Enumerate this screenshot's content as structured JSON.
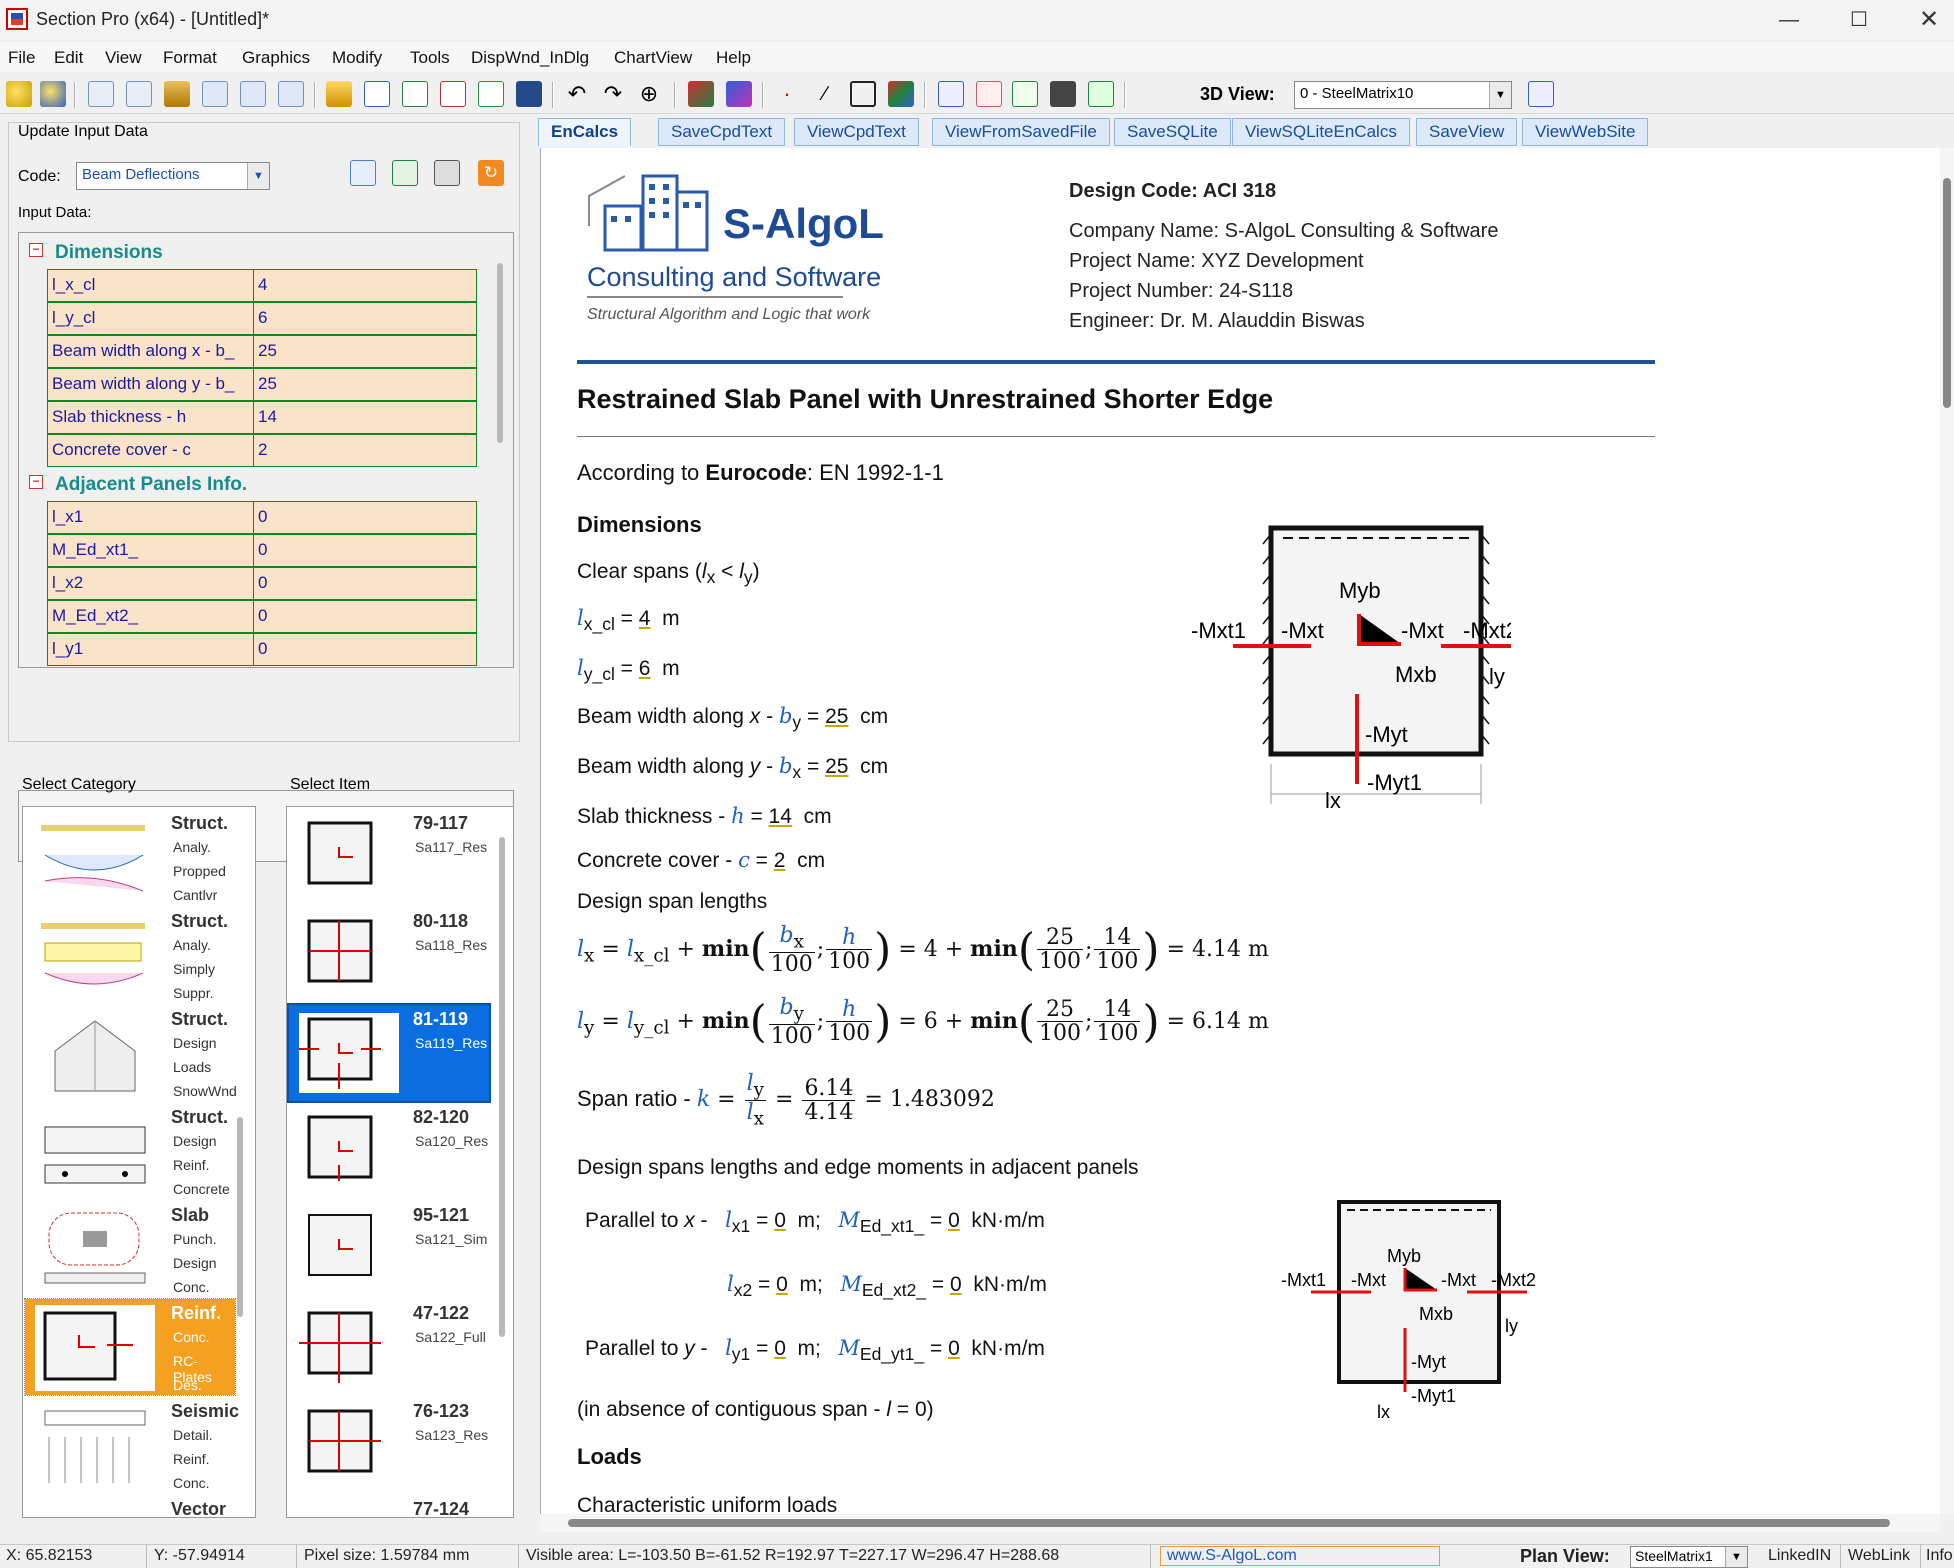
{
  "window": {
    "title": "Section Pro (x64) - [Untitled]*"
  },
  "menu": [
    "File",
    "Edit",
    "View",
    "Format",
    "Graphics",
    "Modify",
    "Tools",
    "DispWnd_InDlg",
    "ChartView",
    "Help"
  ],
  "toolbar": {
    "view3d_label": "3D View:",
    "view3d_value": "0 - SteelMatrix10"
  },
  "left_panel": {
    "header": "Update Input Data",
    "code_label": "Code:",
    "code_value": "Beam Deflections",
    "input_data_label": "Input Data:",
    "groups": [
      {
        "title": "Dimensions",
        "rows": [
          {
            "key": "l_x_cl",
            "value": "4"
          },
          {
            "key": "l_y_cl",
            "value": "6"
          },
          {
            "key": "Beam width along x - b_",
            "value": "25"
          },
          {
            "key": "Beam width along y - b_",
            "value": "25"
          },
          {
            "key": "Slab thickness - h",
            "value": "14"
          },
          {
            "key": "Concrete cover - c",
            "value": "2"
          }
        ]
      },
      {
        "title": "Adjacent Panels Info.",
        "rows": [
          {
            "key": "l_x1",
            "value": "0"
          },
          {
            "key": "M_Ed_xt1_",
            "value": "0"
          },
          {
            "key": "l_x2",
            "value": "0"
          },
          {
            "key": "M_Ed_xt2_",
            "value": "0"
          },
          {
            "key": "l_y1",
            "value": "0"
          }
        ]
      }
    ],
    "select_category_label": "Select Category",
    "select_item_label": "Select Item",
    "categories": [
      {
        "title": "Struct.",
        "lines": [
          "Analy.",
          "Propped",
          "Cantlvr"
        ],
        "selected": false
      },
      {
        "title": "Struct.",
        "lines": [
          "Analy.",
          "Simply",
          "Suppr."
        ],
        "selected": false
      },
      {
        "title": "Struct.",
        "lines": [
          "Design",
          "Loads",
          "SnowWnd"
        ],
        "selected": false
      },
      {
        "title": "Struct.",
        "lines": [
          "Design",
          "Reinf.",
          "Concrete"
        ],
        "selected": false
      },
      {
        "title": "Slab",
        "lines": [
          "Punch.",
          "Design",
          "Conc."
        ],
        "selected": false
      },
      {
        "title": "Reinf.",
        "lines": [
          "Conc.",
          "RC-Plates",
          "Des."
        ],
        "selected": true
      },
      {
        "title": "Seismic",
        "lines": [
          "Detail.",
          "Reinf.",
          "Conc."
        ],
        "selected": false
      },
      {
        "title": "Vector",
        "lines": [],
        "selected": false
      }
    ],
    "items": [
      {
        "code": "79-117",
        "name": "Sa117_Res",
        "selected": false
      },
      {
        "code": "80-118",
        "name": "Sa118_Res",
        "selected": false
      },
      {
        "code": "81-119",
        "name": "Sa119_Res",
        "selected": true
      },
      {
        "code": "82-120",
        "name": "Sa120_Res",
        "selected": false
      },
      {
        "code": "95-121",
        "name": "Sa121_Sim",
        "selected": false
      },
      {
        "code": "47-122",
        "name": "Sa122_Full",
        "selected": false
      },
      {
        "code": "76-123",
        "name": "Sa123_Res",
        "selected": false
      },
      {
        "code": "77-124",
        "name": "",
        "selected": false
      }
    ]
  },
  "tabs": [
    "EnCalcs",
    "SaveCpdText",
    "ViewCpdText",
    "ViewFromSavedFile",
    "SaveSQLite",
    "ViewSQLiteEnCalcs",
    "SaveView",
    "ViewWebSite"
  ],
  "doc": {
    "logo": {
      "name": "S-AlgoL",
      "sub": "Consulting and Software",
      "tagline": "Structural Algorithm and Logic that work"
    },
    "design_code": "Design Code: ACI 318",
    "company": "Company Name: S-AlgoL Consulting & Software",
    "project": "Project Name: XYZ Development",
    "project_number": "Project Number: 24-S118",
    "engineer": "Engineer: Dr. M. Alauddin Biswas",
    "title": "Restrained Slab Panel with Unrestrained Shorter Edge",
    "according_prefix": "According to ",
    "according_code": "Eurocode",
    "according_suffix": ": EN 1992-1-1",
    "dimensions_heading": "Dimensions",
    "clear_spans": "Clear spans (",
    "design_span_lengths": "Design span lengths",
    "adjacent_heading": "Design spans lengths and edge moments in adjacent panels",
    "absence_note": "(in absence of contiguous span - ",
    "loads_heading": "Loads",
    "char_loads": "Characteristic uniform loads",
    "values": {
      "lx_cl": "4",
      "ly_cl": "6",
      "by": "25",
      "bx": "25",
      "h": "14",
      "c": "2",
      "lx": "4.14",
      "ly": "6.14",
      "k": "1.483092",
      "lx1": "0",
      "lx2": "0",
      "ly1": "0",
      "MEd_xt1": "0",
      "MEd_xt2": "0",
      "MEd_yt1": "0"
    },
    "units": {
      "m": "m",
      "cm": "cm",
      "moment": "kN·m/m"
    },
    "diagram_labels": [
      "-Mxt1",
      "-Mxt",
      "Myb",
      "-Mxt",
      "-Mxt2",
      "Mxb",
      "-Myt",
      "-Myt1",
      "lx",
      "ly",
      "lx1",
      "lx2",
      "ly1"
    ]
  },
  "status": {
    "x": "X: 65.82153",
    "y": "Y: -57.94914",
    "pixel": "Pixel size: 1.59784 mm",
    "visible": "Visible area:  L=-103.50  B=-61.52  R=192.97  T=227.17   W=296.47  H=288.68",
    "website": "www.S-AlgoL.com",
    "plan_view_label": "Plan View:",
    "plan_view_value": "SteelMatrix1",
    "links": [
      "LinkedIN",
      "WebLink",
      "Info"
    ]
  }
}
